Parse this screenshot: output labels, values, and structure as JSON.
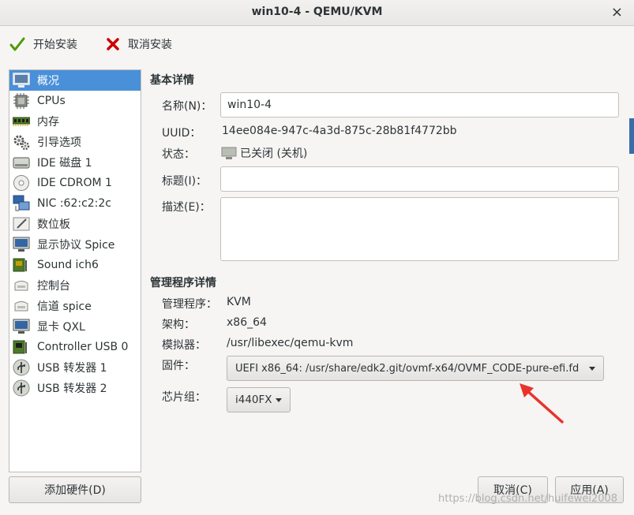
{
  "window": {
    "title": "win10-4 - QEMU/KVM",
    "close_glyph": "×"
  },
  "toolbar": {
    "begin_install": "开始安装",
    "cancel_install": "取消安装"
  },
  "sidebar": {
    "items": [
      {
        "label": "概况",
        "icon": "overview-icon"
      },
      {
        "label": "CPUs",
        "icon": "cpu-icon"
      },
      {
        "label": "内存",
        "icon": "memory-icon"
      },
      {
        "label": "引导选项",
        "icon": "boot-options-icon"
      },
      {
        "label": "IDE 磁盘 1",
        "icon": "disk-icon"
      },
      {
        "label": "IDE CDROM 1",
        "icon": "cdrom-icon"
      },
      {
        "label": "NIC :62:c2:2c",
        "icon": "nic-icon"
      },
      {
        "label": "数位板",
        "icon": "tablet-icon"
      },
      {
        "label": "显示协议 Spice",
        "icon": "display-icon"
      },
      {
        "label": "Sound ich6",
        "icon": "sound-icon"
      },
      {
        "label": "控制台",
        "icon": "console-icon"
      },
      {
        "label": "信道 spice",
        "icon": "channel-icon"
      },
      {
        "label": "显卡 QXL",
        "icon": "video-icon"
      },
      {
        "label": "Controller USB 0",
        "icon": "controller-icon"
      },
      {
        "label": "USB 转发器 1",
        "icon": "usb-icon"
      },
      {
        "label": "USB 转发器 2",
        "icon": "usb-icon"
      }
    ],
    "add_hardware": "添加硬件(D)"
  },
  "basic": {
    "section_title": "基本详情",
    "name_label": "名称(N)：",
    "name_value": "win10-4",
    "uuid_label": "UUID：",
    "uuid_value": "14ee084e-947c-4a3d-875c-28b81f4772bb",
    "status_label": "状态：",
    "status_value": "已关闭 (关机)",
    "title_label": "标题(I)：",
    "title_value": "",
    "desc_label": "描述(E)：",
    "desc_value": ""
  },
  "hypervisor": {
    "section_title": "管理程序详情",
    "hv_label": "管理程序：",
    "hv_value": "KVM",
    "arch_label": "架构：",
    "arch_value": "x86_64",
    "emu_label": "模拟器：",
    "emu_value": "/usr/libexec/qemu-kvm",
    "fw_label": "固件：",
    "fw_value": "UEFI x86_64: /usr/share/edk2.git/ovmf-x64/OVMF_CODE-pure-efi.fd",
    "chip_label": "芯片组：",
    "chip_value": "i440FX"
  },
  "buttons": {
    "cancel": "取消(C)",
    "apply": "应用(A)"
  },
  "watermark": "https://blog.csdn.net/huifewei2008",
  "colors": {
    "selection": "#4a90d9",
    "arrow": "#e8332b",
    "accent_edge": "#3a6da8"
  }
}
